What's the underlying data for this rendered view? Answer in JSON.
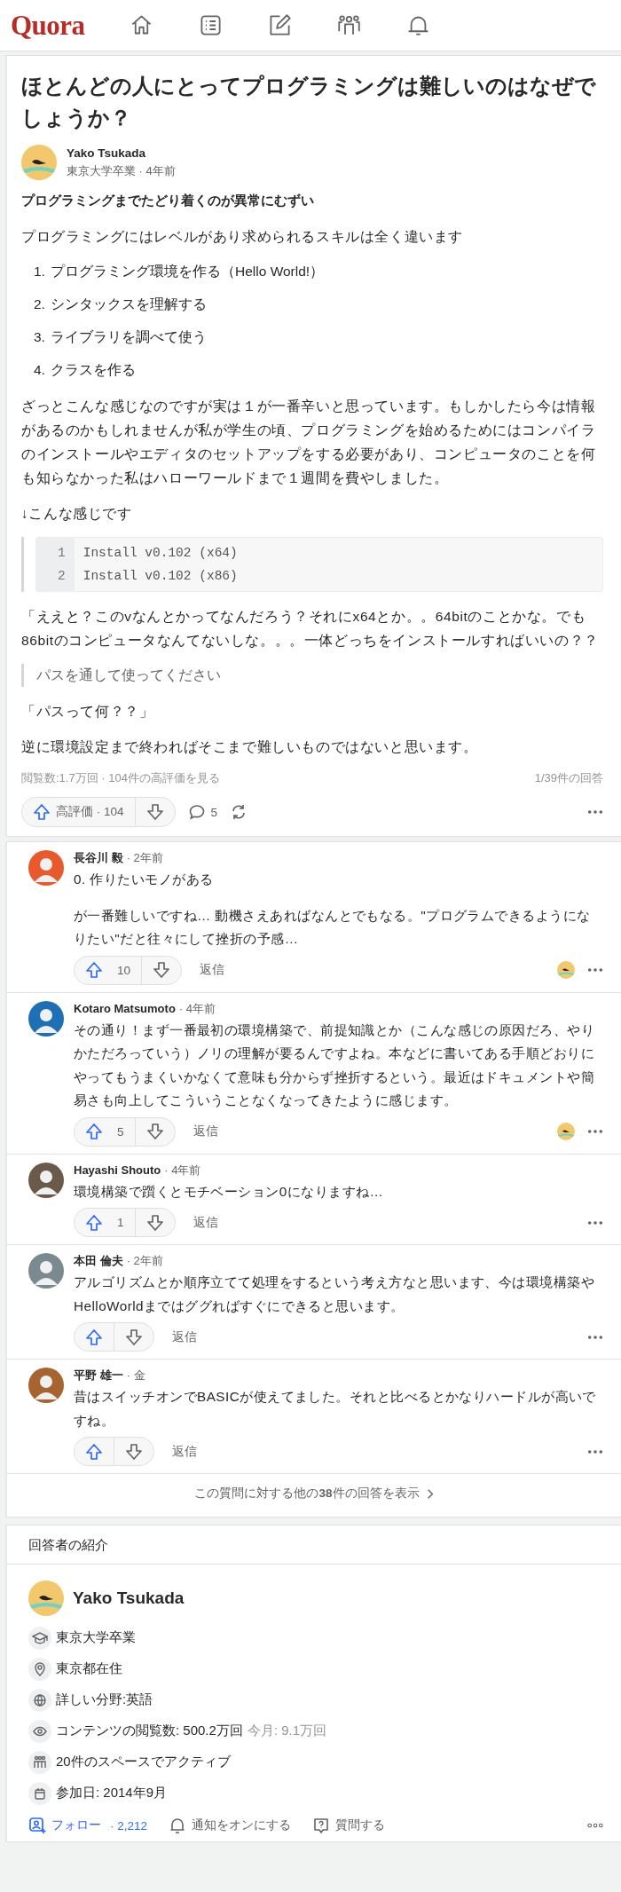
{
  "header": {
    "logo": "Quora"
  },
  "question": {
    "title": "ほとんどの人にとってプログラミングは難しいのはなぜでしょうか？"
  },
  "answer": {
    "author": {
      "name": "Yako Tsukada",
      "meta": "東京大学卒業 · 4年前"
    },
    "blocks": [
      {
        "kind": "heading",
        "text": "プログラミングまでたどり着くのが異常にむずい"
      },
      {
        "kind": "paragraph",
        "text": "プログラミングにはレベルがあり求められるスキルは全く違います"
      },
      {
        "kind": "list",
        "items": [
          {
            "number": "1.",
            "text": "プログラミング環境を作る（Hello World!）"
          },
          {
            "number": "2.",
            "text": "シンタックスを理解する"
          },
          {
            "number": "3.",
            "text": "ライブラリを調べて使う"
          },
          {
            "number": "4.",
            "text": "クラスを作る"
          }
        ]
      },
      {
        "kind": "paragraph",
        "text": "ざっとこんな感じなのですが実は１が一番辛いと思っています。もしかしたら今は情報があるのかもしれませんが私が学生の頃、プログラミングを始めるためにはコンパイラのインストールやエディタのセットアップをする必要があり、コンピュータのことを何も知らなかった私はハローワールドまで１週間を費やしました。"
      },
      {
        "kind": "paragraph",
        "text": "↓こんな感じです"
      },
      {
        "kind": "code",
        "lines": [
          {
            "number": "1",
            "code": "Install v0.102 (x64)"
          },
          {
            "number": "2",
            "code": "Install v0.102 (x86)"
          }
        ]
      },
      {
        "kind": "paragraph",
        "text": "「ええと？このvなんとかってなんだろう？それにx64とか。。64bitのことかな。でも86bitのコンピュータなんてないしな。。。一体どっちをインストールすればいいの？？"
      },
      {
        "kind": "quote",
        "text": "パスを通して使ってください"
      },
      {
        "kind": "paragraph",
        "text": "「パスって何？？」"
      },
      {
        "kind": "paragraph",
        "text": "逆に環境設定まで終わればそこまで難しいものではないと思います。"
      }
    ],
    "stats": "閲覧数:1.7万回 · 104件の高評価を見る",
    "position": "1/39件の回答",
    "upvote": "高評価 · 104",
    "comments": "5"
  },
  "comments": [
    {
      "name": "長谷川 毅",
      "time": "· 2年前",
      "paragraphs": [
        "0. 作りたいモノがある",
        "が一番難しいですね… 動機さえあればなんとでもなる。\"プログラムできるようになりたい\"だと往々にして挫折の予感…"
      ],
      "upvotes": "10",
      "reply": "返信",
      "liked_by_author": true
    },
    {
      "name": "Kotaro Matsumoto",
      "time": "· 4年前",
      "paragraphs": [
        "その通り！まず一番最初の環境構築で、前提知識とか（こんな感じの原因だろ、やりかただろっていう）ノリの理解が要るんですよね。本などに書いてある手順どおりにやってもうまくいかなくて意味も分からず挫折するという。最近はドキュメントや簡易さも向上してこういうことなくなってきたように感じます。"
      ],
      "upvotes": "5",
      "reply": "返信",
      "liked_by_author": true
    },
    {
      "name": "Hayashi Shouto",
      "time": "· 4年前",
      "paragraphs": [
        "環境構築で躓くとモチベーション0になりますね…"
      ],
      "upvotes": "1",
      "reply": "返信",
      "liked_by_author": false
    },
    {
      "name": "本田 倫夫",
      "time": "· 2年前",
      "paragraphs": [
        "アルゴリズムとか順序立てて処理をするという考え方なと思います、今は環境構築やHelloWorldまではググればすぐにできると思います。"
      ],
      "reply": "返信",
      "liked_by_author": false
    },
    {
      "name": "平野 雄一",
      "time": "· 金",
      "paragraphs": [
        "昔はスイッチオンでBASICが使えてました。それと比べるとかなりハードルが高いですね。"
      ],
      "reply": "返信",
      "liked_by_author": false
    }
  ],
  "more_answers": "この質問に対する他の**38**件の回答を表示",
  "profile": {
    "section_title": "回答者の紹介",
    "name": "Yako Tsukada",
    "items": [
      {
        "kind": "education",
        "text": "東京大学卒業"
      },
      {
        "kind": "location",
        "text": "東京都在住"
      },
      {
        "kind": "topic",
        "text": "詳しい分野:英語"
      },
      {
        "kind": "views",
        "text": "コンテンツの閲覧数: 500.2万回",
        "extra": "今月: 9.1万回"
      },
      {
        "kind": "spaces",
        "text": "20件のスペースでアクティブ"
      },
      {
        "kind": "joined",
        "text": "参加日: 2014年9月"
      }
    ],
    "follow": "フォロー",
    "followers": "· 2,212",
    "notify": "通知をオンにする",
    "ask": "質問する"
  }
}
